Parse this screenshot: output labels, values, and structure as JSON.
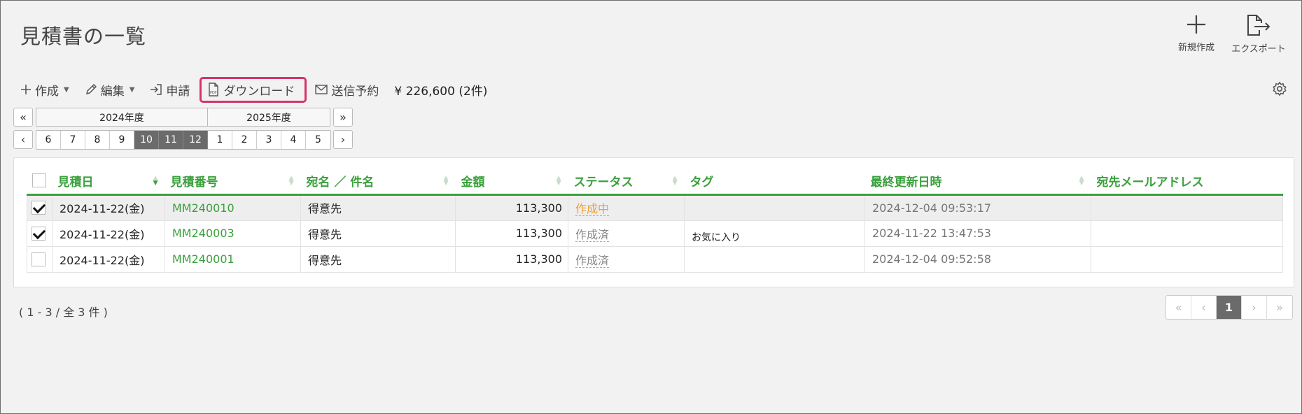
{
  "page": {
    "title": "見積書の一覧"
  },
  "top_actions": {
    "new_label": "新規作成",
    "export_label": "エクスポート"
  },
  "toolbar": {
    "create_label": "作成",
    "edit_label": "編集",
    "apply_label": "申請",
    "download_label": "ダウンロード",
    "schedule_label": "送信予約",
    "total": "¥ 226,600 (2件)"
  },
  "period": {
    "first_label": "«",
    "prev_label": "‹",
    "last_label": "»",
    "next_label": "›",
    "years": [
      "2024年度",
      "2025年度"
    ],
    "months": [
      {
        "label": "6",
        "selected": false
      },
      {
        "label": "7",
        "selected": false
      },
      {
        "label": "8",
        "selected": false
      },
      {
        "label": "9",
        "selected": false
      },
      {
        "label": "10",
        "selected": true
      },
      {
        "label": "11",
        "selected": true
      },
      {
        "label": "12",
        "selected": true
      },
      {
        "label": "1",
        "selected": false
      },
      {
        "label": "2",
        "selected": false
      },
      {
        "label": "3",
        "selected": false
      },
      {
        "label": "4",
        "selected": false
      },
      {
        "label": "5",
        "selected": false
      }
    ]
  },
  "table": {
    "headers": [
      "見積日",
      "見積番号",
      "宛名 ／ 件名",
      "金額",
      "ステータス",
      "タグ",
      "最終更新日時",
      "宛先メールアドレス"
    ],
    "rows": [
      {
        "checked": true,
        "date": "2024-11-22(金)",
        "number": "MM240010",
        "recipient": "得意先",
        "amount": "113,300",
        "status": "作成中",
        "status_color": "#f0a030",
        "tag": "",
        "updated": "2024-12-04 09:53:17",
        "email": ""
      },
      {
        "checked": true,
        "date": "2024-11-22(金)",
        "number": "MM240003",
        "recipient": "得意先",
        "amount": "113,300",
        "status": "作成済",
        "status_color": "#888888",
        "tag": "お気に入り",
        "updated": "2024-11-22 13:47:53",
        "email": ""
      },
      {
        "checked": false,
        "date": "2024-11-22(金)",
        "number": "MM240001",
        "recipient": "得意先",
        "amount": "113,300",
        "status": "作成済",
        "status_color": "#888888",
        "tag": "",
        "updated": "2024-12-04 09:52:58",
        "email": ""
      }
    ]
  },
  "footer": {
    "count_text": "( 1 - 3 / 全 3 件 )",
    "pagination": [
      "«",
      "‹",
      "1",
      "›",
      "»"
    ],
    "current_page": "1"
  },
  "colors": {
    "accent_green": "#3aa03c",
    "highlight_pink": "#d6336c",
    "selected_month": "#6b6b6b"
  }
}
